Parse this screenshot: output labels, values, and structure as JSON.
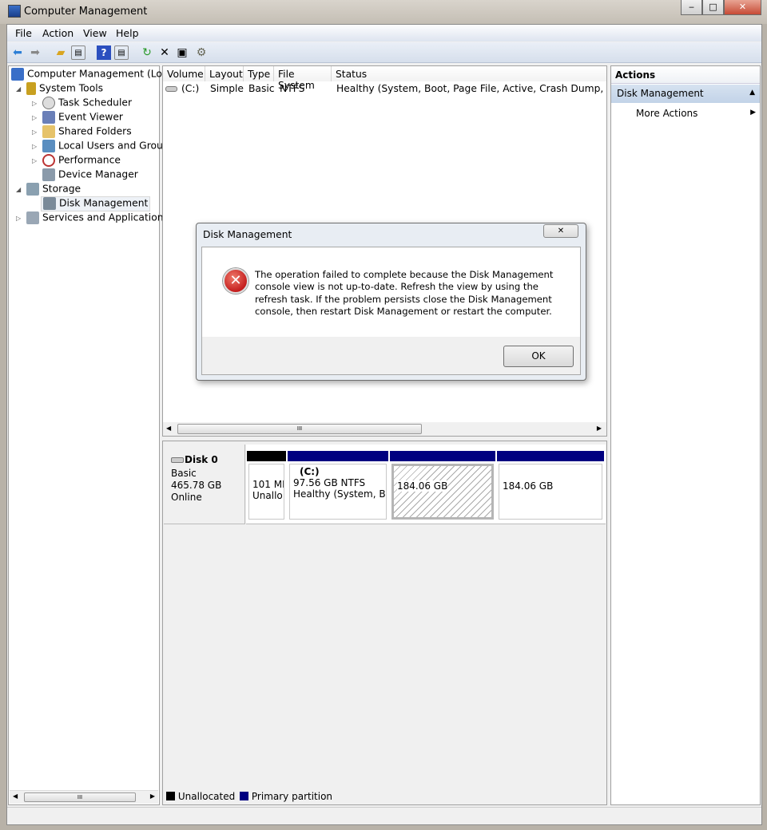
{
  "window": {
    "title": "Computer Management",
    "minimize": "‒",
    "maximize": "□",
    "close": "✕"
  },
  "menu": [
    "File",
    "Action",
    "View",
    "Help"
  ],
  "toolbar": [
    "back",
    "forward",
    "up-folder",
    "show-hide-console-tree",
    "help",
    "show-hide-action-pane",
    "refresh",
    "delete",
    "properties",
    "settings"
  ],
  "tree": {
    "root": "Computer Management (Local",
    "items": [
      {
        "label": "System Tools",
        "level": 1,
        "expanded": true
      },
      {
        "label": "Task Scheduler",
        "level": 2
      },
      {
        "label": "Event Viewer",
        "level": 2
      },
      {
        "label": "Shared Folders",
        "level": 2
      },
      {
        "label": "Local Users and Groups",
        "level": 2
      },
      {
        "label": "Performance",
        "level": 2
      },
      {
        "label": "Device Manager",
        "level": 2
      },
      {
        "label": "Storage",
        "level": 1,
        "expanded": true
      },
      {
        "label": "Disk Management",
        "level": 2,
        "selected": true
      },
      {
        "label": "Services and Applications",
        "level": 1
      }
    ]
  },
  "volumes": {
    "columns": [
      "Volume",
      "Layout",
      "Type",
      "File System",
      "Status"
    ],
    "rows": [
      [
        "(C:)",
        "Simple",
        "Basic",
        "NTFS",
        "Healthy (System, Boot, Page File, Active, Crash Dump, Primary P"
      ]
    ]
  },
  "disk": {
    "name": "Disk 0",
    "type": "Basic",
    "size": "465.78 GB",
    "status": "Online",
    "partitions": [
      {
        "line1": "101 MB",
        "line2": "Unallo",
        "kind": "unallocated"
      },
      {
        "title": "(C:)",
        "line1": "97.56 GB NTFS",
        "line2": "Healthy (System, Boc",
        "kind": "primary"
      },
      {
        "line1": "184.06 GB",
        "kind": "primary",
        "hatched": true
      },
      {
        "line1": "184.06 GB",
        "kind": "primary"
      }
    ]
  },
  "legend": [
    {
      "label": "Unallocated",
      "color": "#000000"
    },
    {
      "label": "Primary partition",
      "color": "#000080"
    }
  ],
  "actions": {
    "header": "Actions",
    "section": "Disk Management",
    "items": [
      "More Actions"
    ]
  },
  "dialog": {
    "title": "Disk Management",
    "close": "✕",
    "icon": "error-icon",
    "message": "The operation failed to complete because the Disk Management console view is not up-to-date.  Refresh the view by using the refresh task. If the problem persists close the Disk Management console, then restart Disk Management or restart the computer.",
    "ok": "OK"
  },
  "scroll": {
    "thumb": "III"
  }
}
